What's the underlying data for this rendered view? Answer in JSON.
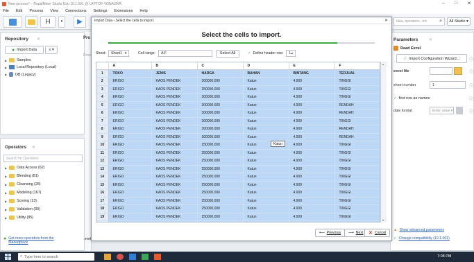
{
  "window": {
    "title": "New process* – RapidMiner Studio Edu 10.1.001 @ LAPTOP-VGNA3IXR",
    "min": "–",
    "max": "□",
    "close": "✕"
  },
  "menu": [
    "File",
    "Edit",
    "Process",
    "View",
    "Connections",
    "Settings",
    "Extensions",
    "Help"
  ],
  "search": {
    "placeholder": "data, operators...etc",
    "studio": "All Studio ▾"
  },
  "repository": {
    "title": "Repository",
    "import_btn": "Import Data",
    "items": [
      {
        "label": "Samples"
      },
      {
        "label": "Local Repository (Local)"
      },
      {
        "label": "DB (Legacy)"
      }
    ],
    "side_labels": {
      "pro": "Pro",
      "proc": "Proce",
      "lev": "Levels"
    }
  },
  "operators": {
    "title": "Operators",
    "search_placeholder": "Search for Operators",
    "items": [
      {
        "label": "Data Access (62)"
      },
      {
        "label": "Blending (81)"
      },
      {
        "label": "Cleansing (28)"
      },
      {
        "label": "Modeling (167)"
      },
      {
        "label": "Scoring (13)"
      },
      {
        "label": "Validation (30)"
      },
      {
        "label": "Utility (85)"
      }
    ],
    "marketplace": "Get more operators from the Marketplace"
  },
  "dialog": {
    "title": "Import Data - Select the cells to import.",
    "heading": "Select the cells to import.",
    "progress": 0.86,
    "sheet_label": "Sheet:",
    "sheet_value": "Sheet1",
    "range_label": "Cell range:",
    "range_value": "A:F",
    "select_all": "Select All",
    "header_label": "Define header row:",
    "header_value": "1",
    "columns": [
      "",
      "A",
      "B",
      "C",
      "D",
      "E",
      "F"
    ],
    "rows": [
      [
        "1",
        "TOKO",
        "JENIS",
        "HARGA",
        "BAHAN",
        "BINTANG",
        "TERJUAL"
      ],
      [
        "2",
        "ERIGO",
        "KAOS PENDEK",
        "300000.000",
        "Katun",
        "4.900",
        "TINGGI"
      ],
      [
        "3",
        "ERIGO",
        "KAOS PENDEK",
        "250000.000",
        "Katun",
        "4.900",
        "TINGGI"
      ],
      [
        "4",
        "ERIGO",
        "KAOS PENDEK",
        "300000.000",
        "Katun",
        "4.900",
        "TINGGI"
      ],
      [
        "5",
        "ERIGO",
        "KAOS PENDEK",
        "300000.000",
        "Katun",
        "4.900",
        "RENDAH"
      ],
      [
        "6",
        "ERIGO",
        "KAOS PENDEK",
        "300000.000",
        "Katun",
        "4.900",
        "RENDAH"
      ],
      [
        "7",
        "ERIGO",
        "KAOS PENDEK",
        "300000.000",
        "Katun",
        "4.900",
        "TINGGI"
      ],
      [
        "8",
        "ERIGO",
        "KAOS PENDEK",
        "300000.000",
        "Katun",
        "4.900",
        "RENDAH"
      ],
      [
        "9",
        "ERIGO",
        "KAOS PENDEK",
        "300000.000",
        "Katun",
        "4.900",
        "RENDAH"
      ],
      [
        "10",
        "ERIGO",
        "KAOS PENDEK",
        "250000.000",
        "Katun",
        "4.900",
        "TINGGI"
      ],
      [
        "11",
        "ERIGO",
        "KAOS PENDEK",
        "250000.000",
        "Katun",
        "4.900",
        "TINGGI"
      ],
      [
        "12",
        "ERIGO",
        "KAOS PENDEK",
        "250000.000",
        "Katun",
        "4.900",
        "TINGGI"
      ],
      [
        "13",
        "ERIGO",
        "KAOS PENDEK",
        "250000.000",
        "Katun",
        "4.900",
        "TINGGI"
      ],
      [
        "14",
        "ERIGO",
        "KAOS PENDEK",
        "250000.000",
        "Katun",
        "4.900",
        "TINGGI"
      ],
      [
        "15",
        "ERIGO",
        "KAOS PENDEK",
        "250000.000",
        "Katun",
        "4.900",
        "TINGGI"
      ],
      [
        "16",
        "ERIGO",
        "KAOS PENDEK",
        "250000.000",
        "Katun",
        "4.900",
        "TINGGI"
      ],
      [
        "17",
        "ERIGO",
        "KAOS PENDEK",
        "250000.000",
        "Katun",
        "4.900",
        "TINGGI"
      ],
      [
        "18",
        "ERIGO",
        "KAOS PENDEK",
        "250000.000",
        "Katun",
        "4.900",
        "TINGGI"
      ],
      [
        "19",
        "ERIGO",
        "KAOS PENDEK",
        "250000.000",
        "Katun",
        "4.900",
        "TINGGI"
      ],
      [
        "20",
        "ERIGO",
        "KAOS PENDEK",
        "250000.000",
        "Katun",
        "4.900",
        "TINGGI"
      ]
    ],
    "tooltip": "Katun",
    "prev": "Previous",
    "next": "Next",
    "cancel": "Cancel"
  },
  "parameters": {
    "title": "Parameters",
    "operator": "Read Excel",
    "wizard": "Import Configuration Wizard...",
    "excel_file": "excel file",
    "sheet_number": "sheet number",
    "sheet_number_value": "1",
    "first_row": "first row as names",
    "date_format": "date format",
    "date_placeholder": "Enter value ▾",
    "advanced": "Show advanced parameters",
    "compat": "Change compatibility (10.1.001)"
  },
  "taskbar": {
    "search": "Type here to search",
    "time": "7:08 PM"
  },
  "colors": {
    "accent": "#37a842",
    "selection": "#bcd8f6",
    "link": "#2a5db0"
  }
}
